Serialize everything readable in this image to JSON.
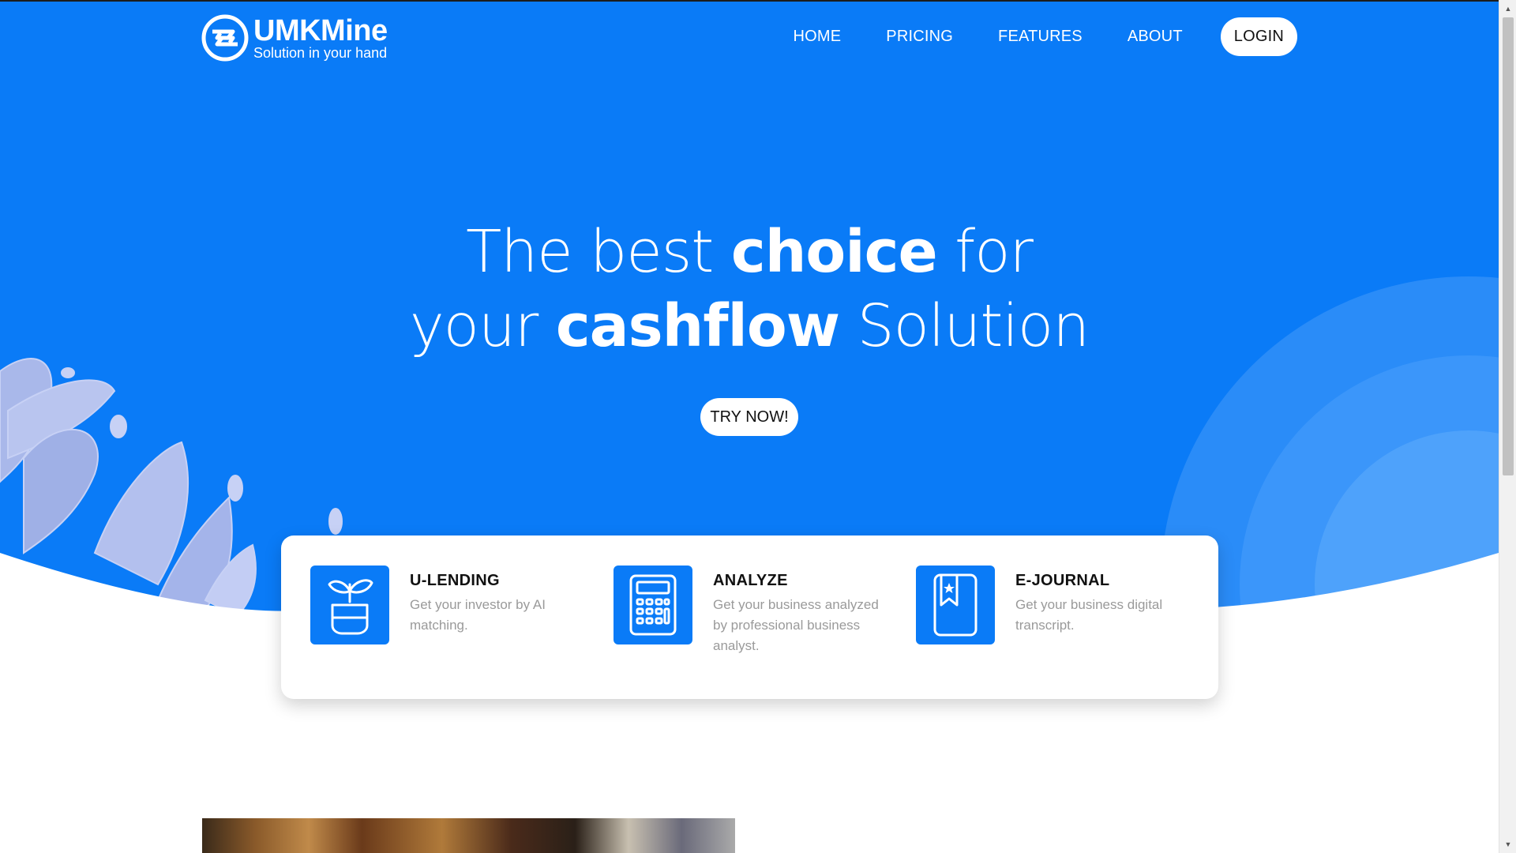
{
  "brand": {
    "name": "UMKMine",
    "tagline": "Solution in your hand"
  },
  "nav": {
    "items": [
      "HOME",
      "PRICING",
      "FEATURES",
      "ABOUT"
    ],
    "login": "LOGIN"
  },
  "hero": {
    "line1_a": "The best ",
    "line1_b": "choice",
    "line1_c": " for",
    "line2_a": "your ",
    "line2_b": "cashflow",
    "line2_c": " Solution",
    "cta": "TRY NOW!"
  },
  "features": [
    {
      "title": "U-LENDING",
      "desc": "Get your investor by AI matching.",
      "icon": "plant-pot-icon"
    },
    {
      "title": "ANALYZE",
      "desc": "Get your business analyzed by professional business analyst.",
      "icon": "calculator-icon"
    },
    {
      "title": "E-JOURNAL",
      "desc": "Get your business digital transcript.",
      "icon": "bookmark-journal-icon"
    }
  ],
  "colors": {
    "primary": "#0a7bf7",
    "white": "#ffffff",
    "muted_text": "#9a9a9a"
  }
}
